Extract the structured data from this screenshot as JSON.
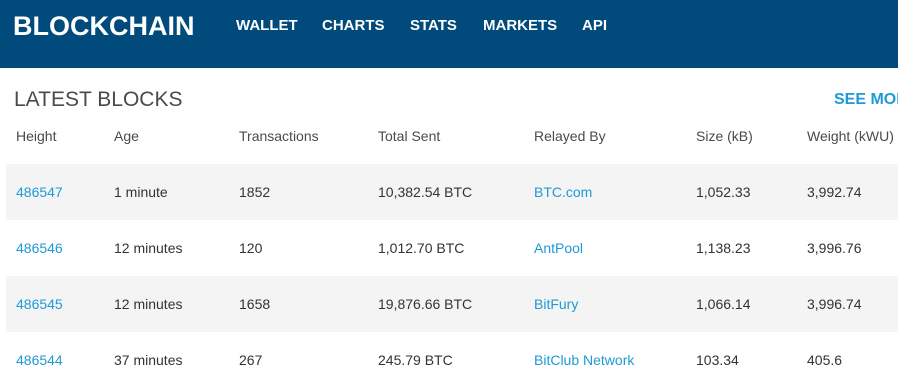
{
  "header": {
    "logo": "BLOCKCHAIN",
    "nav": [
      {
        "label": "WALLET"
      },
      {
        "label": "CHARTS"
      },
      {
        "label": "STATS"
      },
      {
        "label": "MARKETS"
      },
      {
        "label": "API"
      }
    ]
  },
  "section": {
    "title": "LATEST BLOCKS",
    "see_more": "SEE MORE"
  },
  "table": {
    "columns": [
      "Height",
      "Age",
      "Transactions",
      "Total Sent",
      "Relayed By",
      "Size (kB)",
      "Weight (kWU)"
    ],
    "rows": [
      {
        "height": "486547",
        "age": "1 minute",
        "transactions": "1852",
        "total_sent": "10,382.54 BTC",
        "relayed_by": "BTC.com",
        "size": "1,052.33",
        "weight": "3,992.74"
      },
      {
        "height": "486546",
        "age": "12 minutes",
        "transactions": "120",
        "total_sent": "1,012.70 BTC",
        "relayed_by": "AntPool",
        "size": "1,138.23",
        "weight": "3,996.76"
      },
      {
        "height": "486545",
        "age": "12 minutes",
        "transactions": "1658",
        "total_sent": "19,876.66 BTC",
        "relayed_by": "BitFury",
        "size": "1,066.14",
        "weight": "3,996.74"
      },
      {
        "height": "486544",
        "age": "37 minutes",
        "transactions": "267",
        "total_sent": "245.79 BTC",
        "relayed_by": "BitClub Network",
        "size": "103.34",
        "weight": "405.6"
      }
    ]
  },
  "colors": {
    "header_bg": "#004a7c",
    "link": "#1f9ad6",
    "row_shade": "#f4f4f4"
  }
}
